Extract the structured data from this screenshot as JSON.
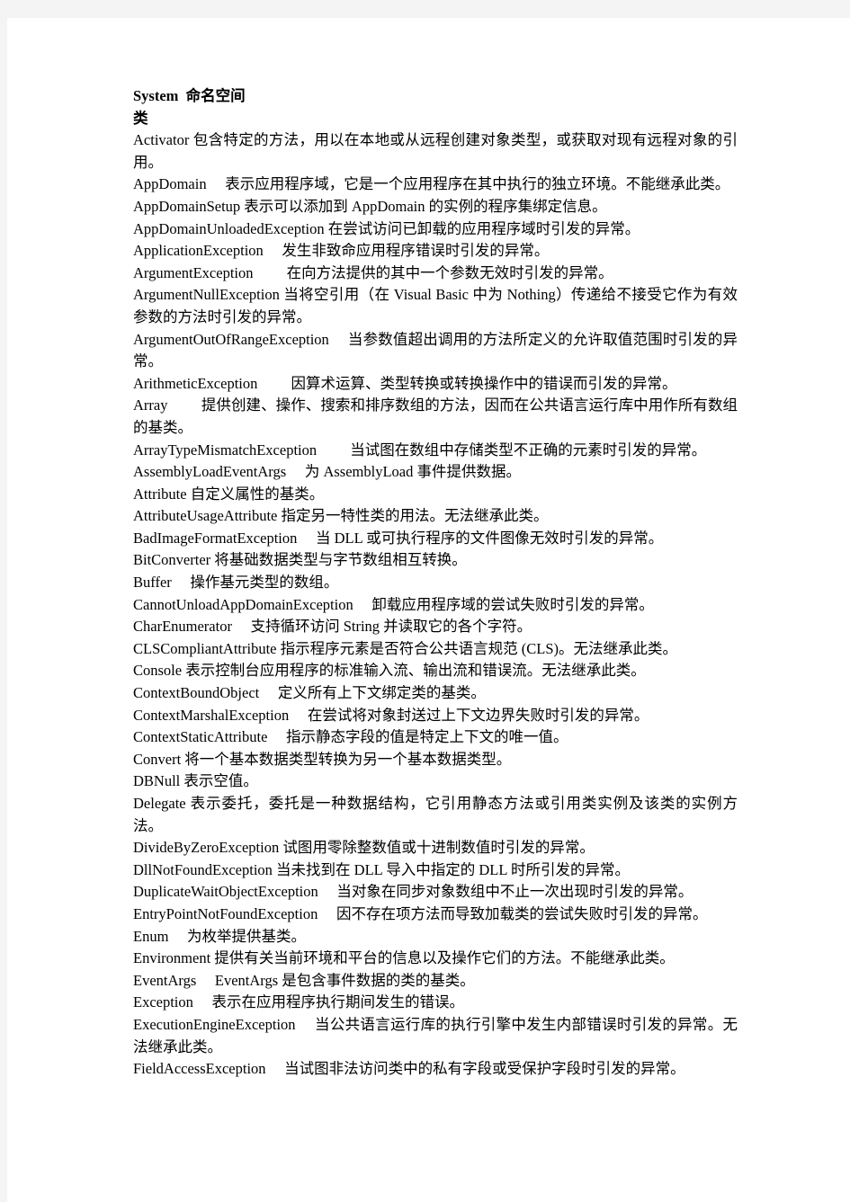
{
  "document": {
    "title": "System  命名空间",
    "section_label": "类",
    "entries": [
      {
        "term": "Activator",
        "desc": " 包含特定的方法，用以在本地或从远程创建对象类型，或获取对现有远程对象的引用。"
      },
      {
        "term": "AppDomain",
        "desc": "　 表示应用程序域，它是一个应用程序在其中执行的独立环境。不能继承此类。"
      },
      {
        "term": "AppDomainSetup",
        "desc": "  表示可以添加到 AppDomain  的实例的程序集绑定信息。"
      },
      {
        "term": "AppDomainUnloadedException",
        "desc": "   在尝试访问已卸载的应用程序域时引发的异常。"
      },
      {
        "term": "ApplicationException",
        "desc": "　 发生非致命应用程序错误时引发的异常。"
      },
      {
        "term": "ArgumentException",
        "desc": "　　 在向方法提供的其中一个参数无效时引发的异常。"
      },
      {
        "term": "ArgumentNullException",
        "desc": " 当将空引用（在 Visual Basic  中为 Nothing）传递给不接受它作为有效参数的方法时引发的异常。"
      },
      {
        "term": "ArgumentOutOfRangeException",
        "desc": "　 当参数值超出调用的方法所定义的允许取值范围时引发的异常。"
      },
      {
        "term": "ArithmeticException",
        "desc": "　　 因算术运算、类型转换或转换操作中的错误而引发的异常。"
      },
      {
        "term": "Array",
        "desc": "　　 提供创建、操作、搜索和排序数组的方法，因而在公共语言运行库中用作所有数组的基类。"
      },
      {
        "term": "ArrayTypeMismatchException",
        "desc": "　　 当试图在数组中存储类型不正确的元素时引发的异常。"
      },
      {
        "term": "AssemblyLoadEventArgs",
        "desc": "　 为 AssemblyLoad  事件提供数据。"
      },
      {
        "term": "Attribute",
        "desc": " 自定义属性的基类。"
      },
      {
        "term": "AttributeUsageAttribute",
        "desc": " 指定另一特性类的用法。无法继承此类。"
      },
      {
        "term": "BadImageFormatException",
        "desc": "　 当 DLL  或可执行程序的文件图像无效时引发的异常。"
      },
      {
        "term": "BitConverter",
        "desc": "  将基础数据类型与字节数组相互转换。"
      },
      {
        "term": "Buffer",
        "desc": "　 操作基元类型的数组。"
      },
      {
        "term": "CannotUnloadAppDomainException",
        "desc": "　 卸载应用程序域的尝试失败时引发的异常。"
      },
      {
        "term": "CharEnumerator",
        "desc": "　 支持循环访问 String  并读取它的各个字符。"
      },
      {
        "term": "CLSCompliantAttribute",
        "desc": " 指示程序元素是否符合公共语言规范 (CLS)。无法继承此类。"
      },
      {
        "term": "Console",
        "desc": "  表示控制台应用程序的标准输入流、输出流和错误流。无法继承此类。"
      },
      {
        "term": "ContextBoundObject",
        "desc": "　 定义所有上下文绑定类的基类。"
      },
      {
        "term": "ContextMarshalException",
        "desc": "　 在尝试将对象封送过上下文边界失败时引发的异常。"
      },
      {
        "term": "ContextStaticAttribute",
        "desc": "　 指示静态字段的值是特定上下文的唯一值。"
      },
      {
        "term": "Convert",
        "desc": "  将一个基本数据类型转换为另一个基本数据类型。"
      },
      {
        "term": "DBNull",
        "desc": "  表示空值。"
      },
      {
        "term": "Delegate",
        "desc": " 表示委托，委托是一种数据结构，它引用静态方法或引用类实例及该类的实例方法。"
      },
      {
        "term": "DivideByZeroException",
        "desc": " 试图用零除整数值或十进制数值时引发的异常。"
      },
      {
        "term": "DllNotFoundException",
        "desc": " 当未找到在 DLL  导入中指定的 DLL  时所引发的异常。"
      },
      {
        "term": "DuplicateWaitObjectException",
        "desc": "　 当对象在同步对象数组中不止一次出现时引发的异常。"
      },
      {
        "term": "EntryPointNotFoundException",
        "desc": "　 因不存在项方法而导致加载类的尝试失败时引发的异常。"
      },
      {
        "term": "Enum",
        "desc": "　 为枚举提供基类。"
      },
      {
        "term": "Environment",
        "desc": "  提供有关当前环境和平台的信息以及操作它们的方法。不能继承此类。"
      },
      {
        "term": "EventArgs",
        "desc": "　 EventArgs  是包含事件数据的类的基类。"
      },
      {
        "term": "Exception",
        "desc": "　 表示在应用程序执行期间发生的错误。"
      },
      {
        "term": "ExecutionEngineException",
        "desc": "　 当公共语言运行库的执行引擎中发生内部错误时引发的异常。无法继承此类。"
      },
      {
        "term": "FieldAccessException",
        "desc": "　 当试图非法访问类中的私有字段或受保护字段时引发的异常。"
      }
    ]
  }
}
